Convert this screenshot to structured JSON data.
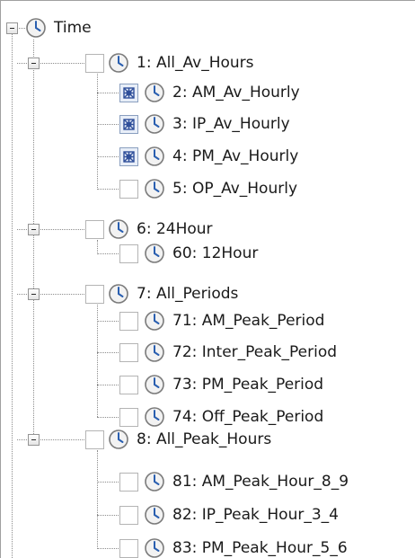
{
  "tree": {
    "root": {
      "label": "Time"
    },
    "nodes": [
      {
        "label": "1: All_Av_Hours",
        "check": "unchecked"
      },
      {
        "label": "2: AM_Av_Hourly",
        "check": "partial"
      },
      {
        "label": "3: IP_Av_Hourly",
        "check": "partial"
      },
      {
        "label": "4: PM_Av_Hourly",
        "check": "partial"
      },
      {
        "label": "5: OP_Av_Hourly",
        "check": "unchecked"
      },
      {
        "label": "6: 24Hour",
        "check": "unchecked"
      },
      {
        "label": "60: 12Hour",
        "check": "unchecked"
      },
      {
        "label": "7: All_Periods",
        "check": "unchecked"
      },
      {
        "label": "71: AM_Peak_Period",
        "check": "unchecked"
      },
      {
        "label": "72: Inter_Peak_Period",
        "check": "unchecked"
      },
      {
        "label": "73: PM_Peak_Period",
        "check": "unchecked"
      },
      {
        "label": "74: Off_Peak_Period",
        "check": "unchecked"
      },
      {
        "label": "8: All_Peak_Hours",
        "check": "unchecked"
      },
      {
        "label": "81: AM_Peak_Hour_8_9",
        "check": "unchecked"
      },
      {
        "label": "82: IP_Peak_Hour_3_4",
        "check": "unchecked"
      },
      {
        "label": "83: PM_Peak_Hour_5_6",
        "check": "unchecked"
      }
    ]
  },
  "colors": {
    "line": "#8c8c8c",
    "text": "#1a1a1a",
    "clock_face": "#f2f2f2",
    "clock_rim": "#7a7a7a",
    "clock_hand": "#2a5fb0",
    "partial_mark": "#2f4f9a"
  }
}
